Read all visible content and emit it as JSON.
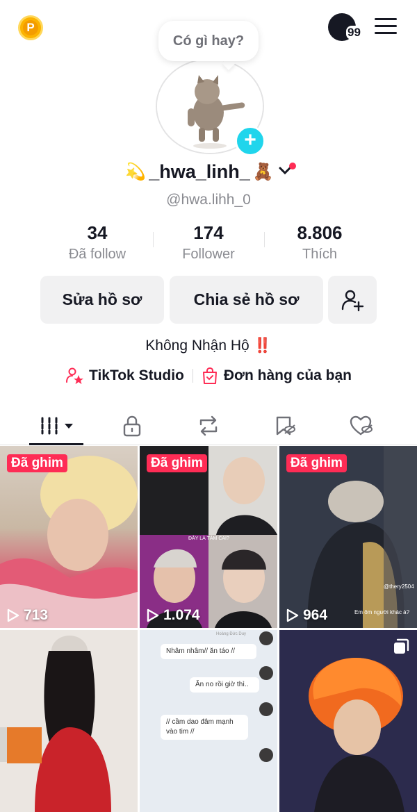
{
  "topbar": {
    "coin_letter": "P",
    "notification_count": "99"
  },
  "avatar": {
    "bubble_text": "Có gì hay?",
    "add_symbol": "+"
  },
  "profile": {
    "display_name": "_hwa_linh_",
    "name_prefix_emoji": "💫",
    "name_suffix_emoji": "🧸",
    "username": "@hwa.lihh_0",
    "bio": "Không Nhận Hộ ‼️"
  },
  "stats": [
    {
      "value": "34",
      "label": "Đã follow"
    },
    {
      "value": "174",
      "label": "Follower"
    },
    {
      "value": "8.806",
      "label": "Thích"
    }
  ],
  "buttons": {
    "edit_profile": "Sửa hồ sơ",
    "share_profile": "Chia sẻ hồ sơ"
  },
  "links": {
    "studio": "TikTok Studio",
    "orders": "Đơn hàng của bạn"
  },
  "colors": {
    "accent": "#fe2c55",
    "teal": "#20d5ec",
    "text": "#161823",
    "secondary": "#8a8b91",
    "button_bg": "#f1f1f2"
  },
  "videos": [
    {
      "pinned_label": "Đã ghim",
      "views": "713",
      "pinned": true
    },
    {
      "pinned_label": "Đã ghim",
      "views": "1.074",
      "pinned": true
    },
    {
      "pinned_label": "Đã ghim",
      "views": "964",
      "pinned": true
    },
    {
      "pinned_label": "",
      "views": "",
      "pinned": false
    },
    {
      "pinned_label": "",
      "views": "",
      "pinned": false
    },
    {
      "pinned_label": "",
      "views": "",
      "pinned": false
    }
  ],
  "video_texts": {
    "chat_sender": "Hoàng Đức Duy",
    "chat_msg_1": "Nhâm nhâm// ăn táo //",
    "chat_msg_2": "Ăn no rồi giờ thì..",
    "chat_msg_3": "// cầm dao đâm mạnh vào tim //",
    "overlay_caption": "Em ôm người khác à?",
    "overlay_handle": "@thery2504",
    "overlay_title": "ĐÂY LÀ TÁM CAI?"
  }
}
